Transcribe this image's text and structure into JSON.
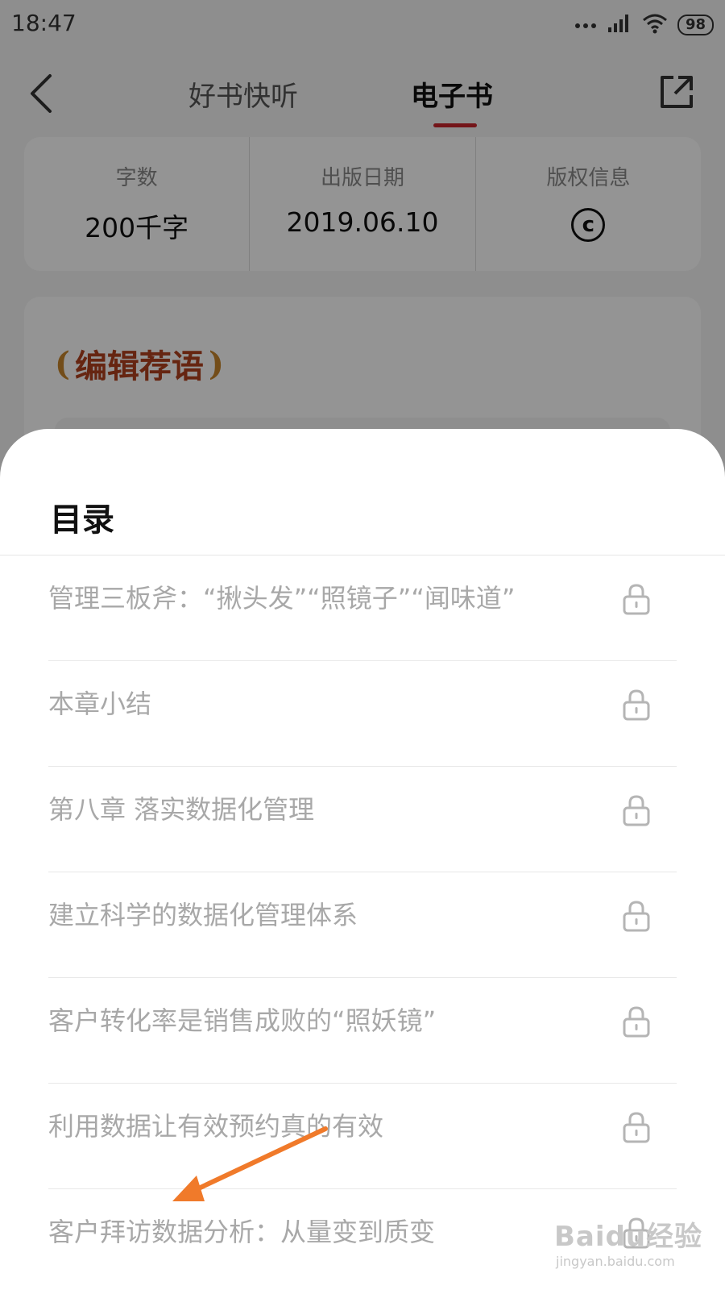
{
  "status_bar": {
    "time": "18:47",
    "battery": "98"
  },
  "nav": {
    "tabs": [
      "好书快听",
      "电子书"
    ],
    "active_tab": "电子书"
  },
  "info": {
    "word_count_label": "字数",
    "word_count": "200千字",
    "pub_date_label": "出版日期",
    "pub_date": "2019.06.10",
    "copyright_label": "版权信息"
  },
  "editor_section": {
    "title": "编辑荐语"
  },
  "toc": {
    "title": "目录",
    "items": [
      "管理三板斧：“揪头发”“照镜子”“闻味道”",
      "本章小结",
      "第八章 落实数据化管理",
      "建立科学的数据化管理体系",
      "客户转化率是销售成败的“照妖镜”",
      "利用数据让有效预约真的有效",
      "客户拜访数据分析：从量变到质变"
    ]
  },
  "watermark": {
    "brand": "Baidu经验",
    "url": "jingyan.baidu.com"
  },
  "colors": {
    "accent": "#c9252c",
    "arrow": "#f07a2a"
  }
}
